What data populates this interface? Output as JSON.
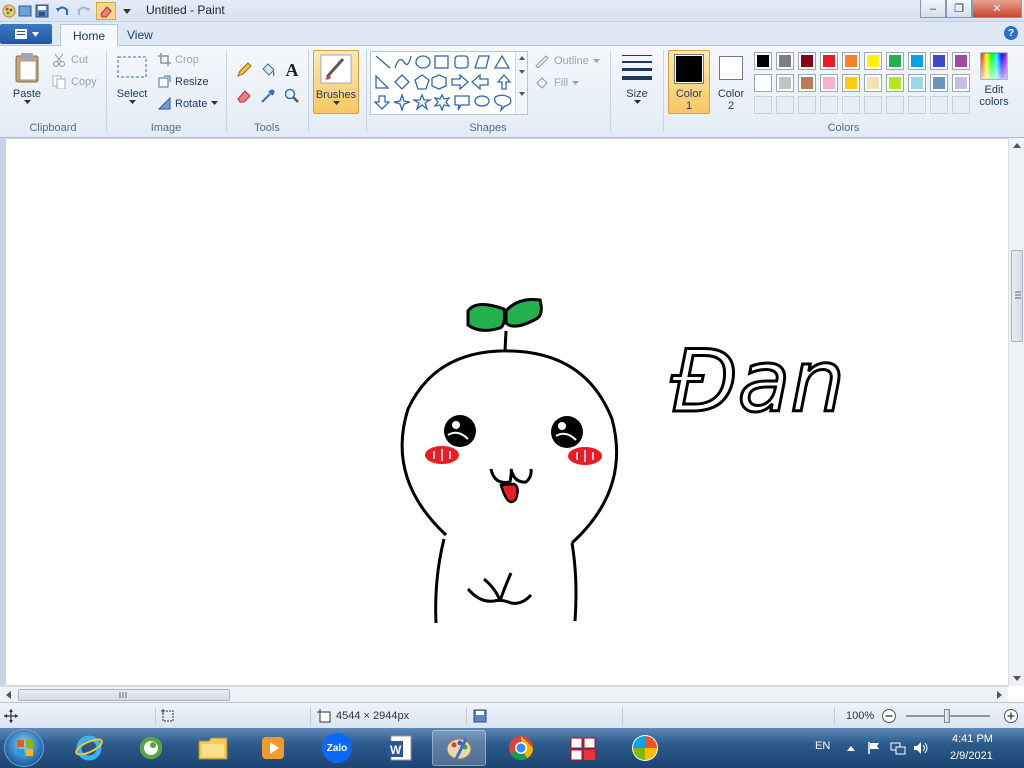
{
  "title_bar": {
    "title": "Untitled - Paint",
    "minimize": "‒",
    "restore": "❐",
    "close": "✕"
  },
  "tabs": {
    "home": "Home",
    "view": "View"
  },
  "clipboard": {
    "paste": "Paste",
    "cut": "Cut",
    "copy": "Copy",
    "label": "Clipboard"
  },
  "image": {
    "select": "Select",
    "crop": "Crop",
    "resize": "Resize",
    "rotate": "Rotate",
    "label": "Image"
  },
  "tools": {
    "label": "Tools"
  },
  "brushes": {
    "label": "Brushes"
  },
  "shapes": {
    "outline": "Outline",
    "fill": "Fill",
    "label": "Shapes"
  },
  "size": {
    "label": "Size"
  },
  "colors": {
    "color1_label_line1": "Color",
    "color1_label_line2": "1",
    "color2_label_line1": "Color",
    "color2_label_line2": "2",
    "edit_line1": "Edit",
    "edit_line2": "colors",
    "label": "Colors",
    "color1": "#000000",
    "color2": "#ffffff",
    "palette_row1": [
      "#000000",
      "#7f7f7f",
      "#880015",
      "#ed1c24",
      "#ff7f27",
      "#fff200",
      "#22b14c",
      "#00a2e8",
      "#3f48cc",
      "#a349a4"
    ],
    "palette_row2": [
      "#ffffff",
      "#c3c3c3",
      "#b97a57",
      "#ffaec9",
      "#ffc90e",
      "#efe4b0",
      "#b5e61d",
      "#99d9ea",
      "#7092be",
      "#c8bfe7"
    ]
  },
  "drawing": {
    "handwriting": "Đan"
  },
  "status": {
    "canvas_size": "4544 × 2944px",
    "zoom": "100%"
  },
  "taskbar": {
    "language": "EN",
    "time": "4:41 PM",
    "date": "2/9/2021",
    "zalo": "Zalo"
  }
}
